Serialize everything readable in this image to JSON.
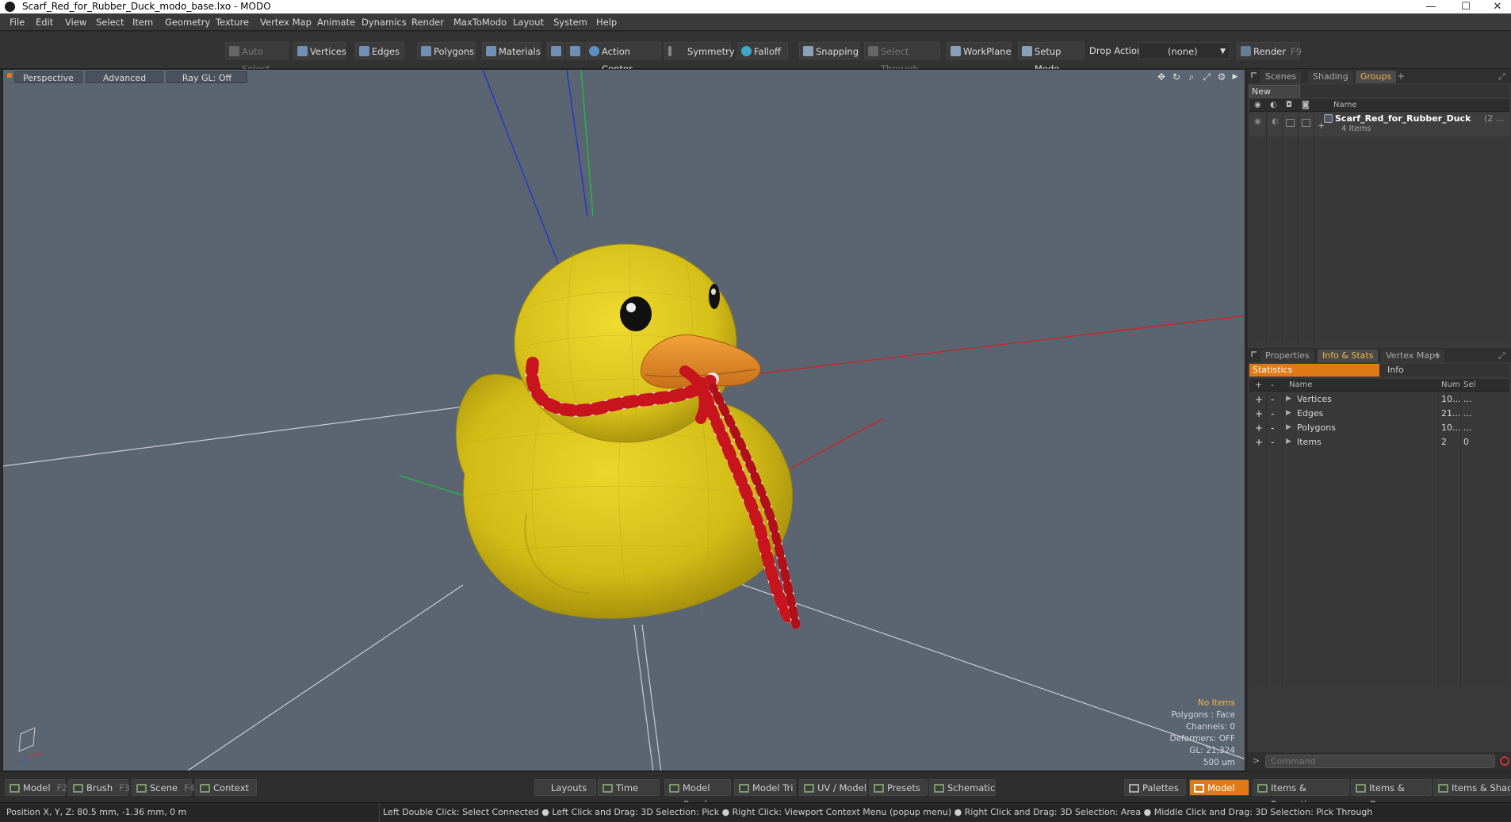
{
  "window": {
    "title": "Scarf_Red_for_Rubber_Duck_modo_base.lxo - MODO",
    "minimize": "—",
    "maximize": "☐",
    "close": "✕"
  },
  "menu": [
    "File",
    "Edit",
    "View",
    "Select",
    "Item",
    "Geometry",
    "Texture",
    "Vertex Map",
    "Animate",
    "Dynamics",
    "Render",
    "MaxToModo",
    "Layout",
    "System",
    "Help"
  ],
  "toolbar": {
    "auto_select": "Auto Select",
    "vertices": "Vertices",
    "edges": "Edges",
    "polygons": "Polygons",
    "materials": "Materials",
    "action_center": "Action Center",
    "symmetry": "Symmetry",
    "falloff": "Falloff",
    "snapping": "Snapping",
    "select_through": "Select Through",
    "workplane": "WorkPlane",
    "setup_mode": "Setup Mode",
    "drop_action": "Drop Action",
    "drop_action_value": "(none)",
    "render": "Render",
    "render_key": "F9"
  },
  "viewport": {
    "tabs": {
      "perspective": "Perspective",
      "advanced": "Advanced",
      "raygl": "Ray GL: Off"
    },
    "stats": {
      "selection": "No Items",
      "polygons": "Polygons : Face",
      "channels": "Channels: 0",
      "deformers": "Deformers: OFF",
      "gl": "GL: 21,324",
      "scale": "500 um"
    }
  },
  "groups_panel": {
    "tabs": [
      "Scenes",
      "Shading",
      "Groups"
    ],
    "active_tab": "Groups",
    "new_group": "New Group",
    "col_name": "Name",
    "item_name": "Scarf_Red_for_Rubber_Duck",
    "item_suffix": "(2 ...",
    "item_count": "4 Items"
  },
  "info_panel": {
    "tabs": [
      "Properties",
      "Info & Stats",
      "Vertex Maps"
    ],
    "active_tab": "Info & Stats",
    "sub_tabs": {
      "statistics": "Statistics",
      "info": "Info"
    },
    "columns": {
      "name": "Name",
      "num": "Num",
      "sel": "Sel"
    },
    "rows": [
      {
        "name": "Vertices",
        "num": "10...",
        "sel": "..."
      },
      {
        "name": "Edges",
        "num": "21...",
        "sel": "..."
      },
      {
        "name": "Polygons",
        "num": "10...",
        "sel": "..."
      },
      {
        "name": "Items",
        "num": "2",
        "sel": "0"
      }
    ],
    "command_placeholder": "Command"
  },
  "bottom": {
    "model": "Model",
    "model_key": "F2",
    "brush": "Brush",
    "brush_key": "F3",
    "scene": "Scene",
    "scene_key": "F4",
    "context": "Context",
    "layouts": "Layouts",
    "time": "Time",
    "model_quad": "Model Quad",
    "model_tri": "Model Tri",
    "uv_model": "UV / Model",
    "presets": "Presets",
    "schematic": "Schematic",
    "palettes": "Palettes",
    "model_mode": "Model",
    "items_properties": "Items & Properties",
    "items_groups": "Items & Groups",
    "items_shading": "Items & Shading"
  },
  "status": {
    "position": "Position X, Y, Z:   80.5 mm, -1.36 mm, 0 m",
    "hints": "Left Double Click: Select Connected ●  Left Click and Drag: 3D Selection: Pick ●  Right Click: Viewport Context Menu (popup menu) ●  Right Click and Drag: 3D Selection: Area ●  Middle Click and Drag: 3D Selection: Pick Through"
  },
  "colors": {
    "accent": "#e07a16",
    "viewport_bg": "#5b6572",
    "duck_yellow": "#d9c21a",
    "beak_orange": "#e08a1e",
    "scarf_red": "#c8141c"
  }
}
